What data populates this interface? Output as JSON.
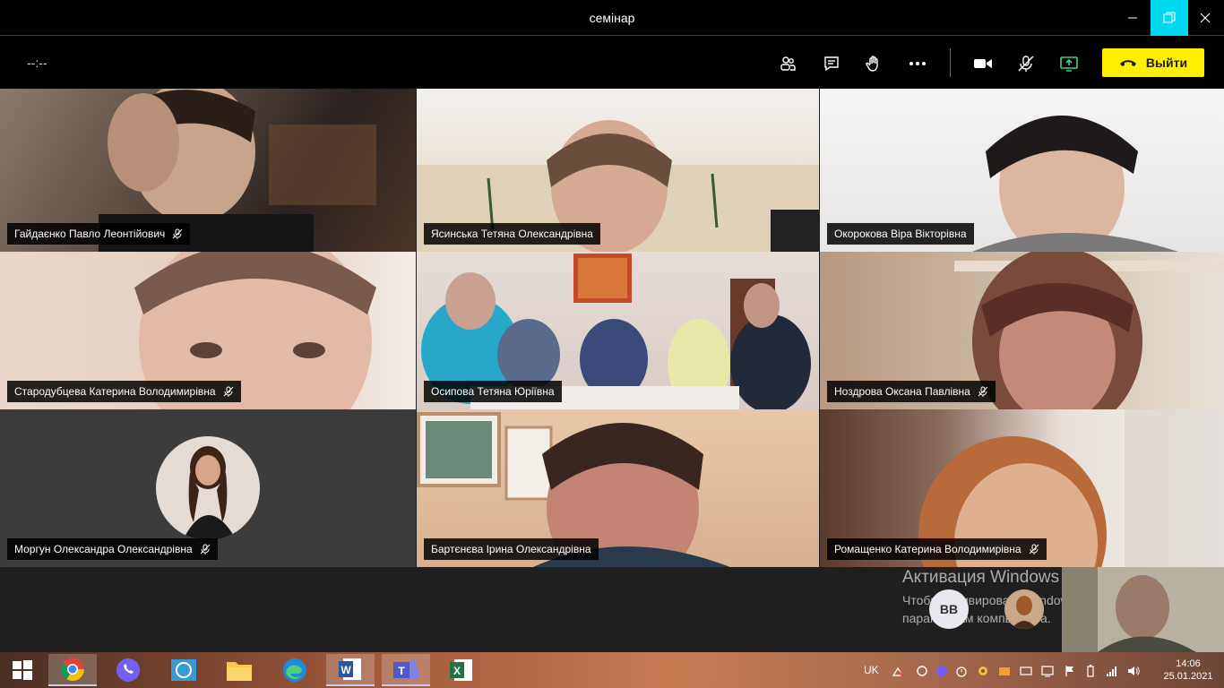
{
  "window": {
    "title": "семінар"
  },
  "toolbar": {
    "timer": "--:--",
    "leave_label": "Выйти",
    "colors": {
      "leave_bg": "#fff000",
      "restore_bg": "#00d8f0"
    },
    "icons": [
      "participants-icon",
      "chat-icon",
      "raise-hand-icon",
      "more-icon",
      "camera-icon",
      "mic-muted-icon",
      "share-screen-icon"
    ]
  },
  "participants": [
    {
      "name": "Гайдаєнко Павло Леонтійович",
      "muted": true
    },
    {
      "name": "Ясинська Тетяна Олександрівна",
      "muted": false
    },
    {
      "name": "Окорокова Віра Вікторівна",
      "muted": false
    },
    {
      "name": "Стародубцева Катерина Володимирівна",
      "muted": true
    },
    {
      "name": "Осипова Тетяна Юріївна",
      "muted": false
    },
    {
      "name": "Ноздрова Оксана Павлівна",
      "muted": true
    },
    {
      "name": "Моргун Олександра Олександрівна",
      "muted": true
    },
    {
      "name": "Бартєнєва Ірина Олександрівна",
      "muted": false
    },
    {
      "name": "Ромащенко Катерина Володимирівна",
      "muted": true
    }
  ],
  "overflow": {
    "initials": "BB"
  },
  "watermark": {
    "line1": "Активация Windows",
    "line2": "Чтобы активировать Windows, перейдите к параметрам компьютера."
  },
  "taskbar": {
    "apps": [
      "windows-start-icon",
      "chrome-icon",
      "viber-icon",
      "photo-app-icon",
      "file-explorer-icon",
      "edge-icon",
      "word-icon",
      "teams-icon",
      "excel-icon"
    ],
    "language": "UK",
    "time": "14:06",
    "date": "25.01.2021"
  }
}
